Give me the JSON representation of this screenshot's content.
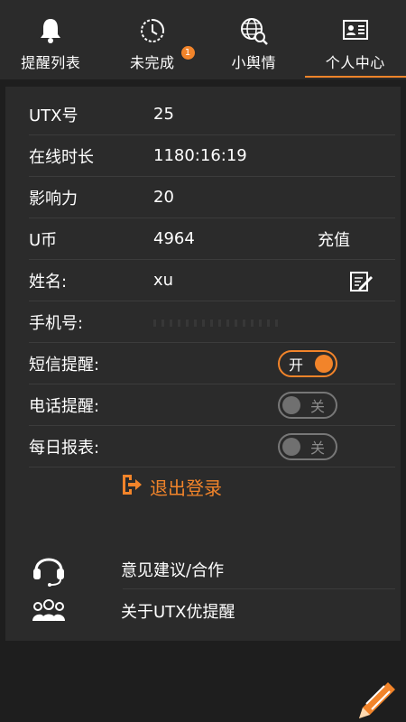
{
  "tabs": [
    {
      "label": "提醒列表",
      "icon": "bell-icon"
    },
    {
      "label": "未完成",
      "icon": "clock-icon",
      "badge": "1"
    },
    {
      "label": "小舆情",
      "icon": "globe-search-icon"
    },
    {
      "label": "个人中心",
      "icon": "id-card-icon",
      "active": true
    }
  ],
  "profile": {
    "utx": {
      "label": "UTX号",
      "value": "25"
    },
    "online": {
      "label": "在线时长",
      "value": "1180:16:19"
    },
    "influence": {
      "label": "影响力",
      "value": "20"
    },
    "coins": {
      "label": "U币",
      "value": "4964",
      "action": "充值"
    },
    "name": {
      "label": "姓名:",
      "value": "xu"
    },
    "phone": {
      "label": "手机号:"
    },
    "sms": {
      "label": "短信提醒:",
      "toggle": "开",
      "on": true
    },
    "call": {
      "label": "电话提醒:",
      "toggle": "关",
      "on": false
    },
    "daily": {
      "label": "每日报表:",
      "toggle": "关",
      "on": false
    }
  },
  "logout": {
    "label": "退出登录"
  },
  "menu": {
    "feedback": {
      "label": "意见建议/合作",
      "icon": "headset-icon"
    },
    "about": {
      "label": "关于UTX优提醒",
      "icon": "group-icon"
    }
  },
  "colors": {
    "accent": "#f2842a",
    "background": "#1e1e1e",
    "card": "#2b2b2b"
  }
}
